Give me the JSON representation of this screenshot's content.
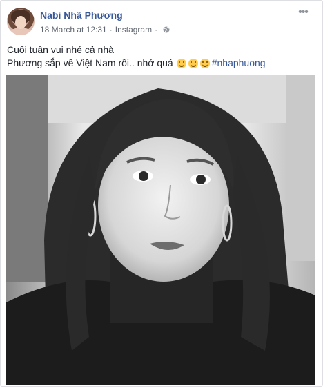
{
  "post": {
    "author": "Nabi Nhã Phương",
    "date": "18 March at 12:31",
    "separator": "·",
    "source": "Instagram",
    "privacy_icon": "globe-icon",
    "more_icon": "more-options-icon",
    "text_line1": "Cuối tuần vui nhé cả nhà",
    "text_line2": "Phương sắp về Việt Nam rồi.. nhớ quá",
    "emoji_icons": [
      "smiling-face-icon",
      "smiling-face-icon",
      "smiling-face-icon"
    ],
    "hashtag": "#nhaphuong",
    "photo_icon": "portrait-photo"
  },
  "colors": {
    "link": "#385898",
    "meta": "#616770",
    "text": "#1d2129",
    "border": "#dddfe2"
  }
}
